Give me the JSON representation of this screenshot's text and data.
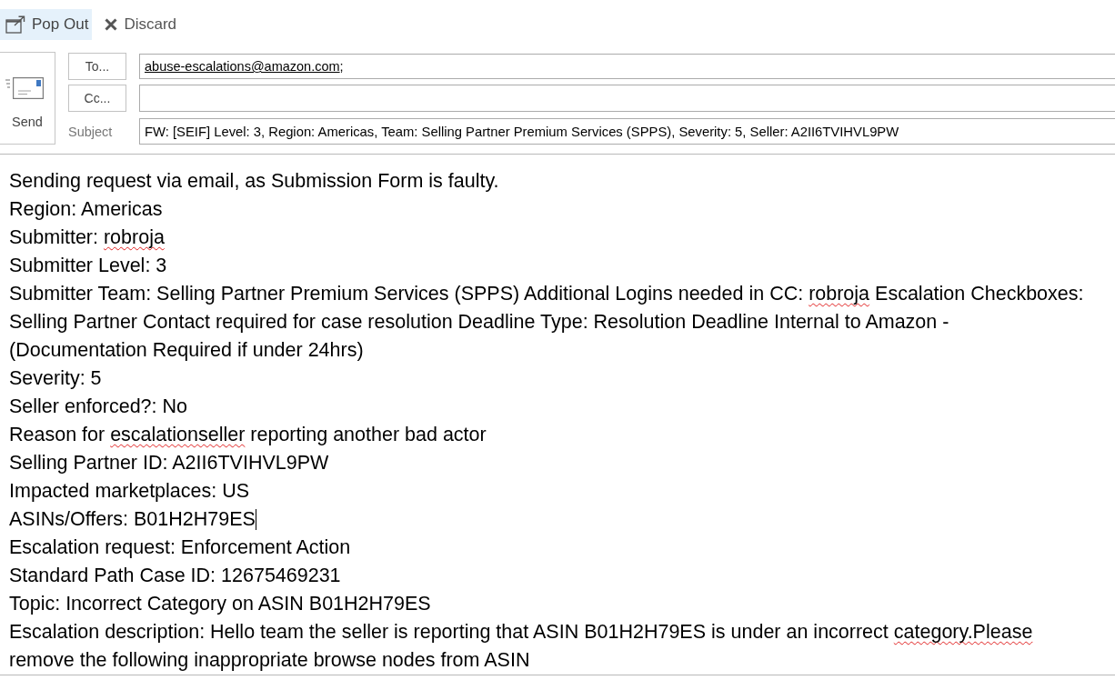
{
  "toolbar": {
    "buttons": [
      {
        "label": "Pop Out",
        "kind": "popout",
        "hovered": true
      },
      {
        "label": "Discard",
        "kind": "discard",
        "hovered": false
      }
    ]
  },
  "compose": {
    "send_button": {
      "label": "Send"
    },
    "to": {
      "button": "To...",
      "recipients": [
        {
          "address": "abuse-escalations@amazon.com",
          "suffix": ";",
          "resolved": true
        }
      ]
    },
    "cc": {
      "button": "Cc..."
    },
    "subject": {
      "label": "Subject",
      "value": "FW: [SEIF] Level: 3, Region: Americas, Team: Selling Partner Premium Services (SPPS), Severity: 5, Seller: A2II6TVIHVL9PW"
    }
  },
  "body": {
    "lines": [
      {
        "segments": [
          {
            "text": "Sending request via email, as Submission Form is faulty.",
            "misspelled": false
          }
        ],
        "cursor": false
      },
      {
        "segments": [
          {
            "text": "Region: Americas",
            "misspelled": false
          }
        ],
        "cursor": false
      },
      {
        "segments": [
          {
            "text": "Submitter: ",
            "misspelled": false
          },
          {
            "text": "robroja",
            "misspelled": true
          }
        ],
        "cursor": false
      },
      {
        "segments": [
          {
            "text": "Submitter Level: 3",
            "misspelled": false
          }
        ],
        "cursor": false
      },
      {
        "segments": [
          {
            "text": "Submitter Team: Selling Partner Premium Services (SPPS) Additional Logins needed in CC: ",
            "misspelled": false
          },
          {
            "text": "robroja",
            "misspelled": true
          },
          {
            "text": " Escalation Checkboxes:",
            "misspelled": false
          }
        ],
        "cursor": false
      },
      {
        "segments": [
          {
            "text": "Selling Partner Contact required for case resolution Deadline Type: Resolution Deadline Internal to Amazon -",
            "misspelled": false
          }
        ],
        "cursor": false
      },
      {
        "segments": [
          {
            "text": "(Documentation Required if under 24hrs)",
            "misspelled": false
          }
        ],
        "cursor": false
      },
      {
        "segments": [
          {
            "text": "Severity: 5",
            "misspelled": false
          }
        ],
        "cursor": false
      },
      {
        "segments": [
          {
            "text": "Seller enforced?: No",
            "misspelled": false
          }
        ],
        "cursor": false
      },
      {
        "segments": [
          {
            "text": "Reason for ",
            "misspelled": false
          },
          {
            "text": "escalationseller",
            "misspelled": true
          },
          {
            "text": " reporting another bad actor",
            "misspelled": false
          }
        ],
        "cursor": false
      },
      {
        "segments": [
          {
            "text": "Selling Partner ID: A2II6TVIHVL9PW",
            "misspelled": false
          }
        ],
        "cursor": false
      },
      {
        "segments": [
          {
            "text": "Impacted marketplaces: US",
            "misspelled": false
          }
        ],
        "cursor": false
      },
      {
        "segments": [
          {
            "text": "ASINs/Offers: B01H2H79ES",
            "misspelled": false
          }
        ],
        "cursor": true
      },
      {
        "segments": [
          {
            "text": "Escalation request: Enforcement Action",
            "misspelled": false
          }
        ],
        "cursor": false
      },
      {
        "segments": [
          {
            "text": "Standard Path Case ID: 12675469231",
            "misspelled": false
          }
        ],
        "cursor": false
      },
      {
        "segments": [
          {
            "text": "Topic: Incorrect Category on ASIN B01H2H79ES",
            "misspelled": false
          }
        ],
        "cursor": false
      },
      {
        "segments": [
          {
            "text": "Escalation description: Hello team the seller is reporting that ASIN B01H2H79ES is under an incorrect ",
            "misspelled": false
          },
          {
            "text": "category.Please",
            "misspelled": true
          }
        ],
        "cursor": false
      },
      {
        "segments": [
          {
            "text": "remove the following inappropriate browse nodes from ASIN",
            "misspelled": false
          }
        ],
        "cursor": false
      }
    ]
  }
}
